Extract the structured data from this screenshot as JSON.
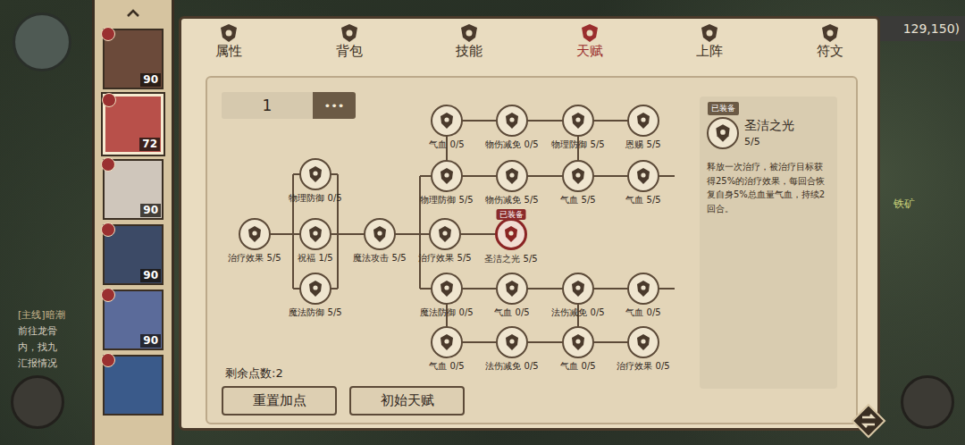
{
  "map": {
    "coords": "129,150)",
    "ore_label": "铁矿",
    "quest": {
      "title": "[主线]暗潮",
      "lines": [
        "前往龙骨",
        "内，找九",
        "汇报情况"
      ]
    }
  },
  "heroes": [
    {
      "level": "90",
      "selected": false,
      "color": "#6b4a3a"
    },
    {
      "level": "72",
      "selected": true,
      "color": "#b8504a"
    },
    {
      "level": "90",
      "selected": false,
      "color": "#cfc6bb"
    },
    {
      "level": "90",
      "selected": false,
      "color": "#3c4a66"
    },
    {
      "level": "90",
      "selected": false,
      "color": "#5b6b9a"
    },
    {
      "selected": false,
      "color": "#3a5a8a"
    }
  ],
  "tabs": [
    {
      "label": "属性",
      "selected": false
    },
    {
      "label": "背包",
      "selected": false
    },
    {
      "label": "技能",
      "selected": false
    },
    {
      "label": "天赋",
      "selected": true
    },
    {
      "label": "上阵",
      "selected": false
    },
    {
      "label": "符文",
      "selected": false
    }
  ],
  "page_input": {
    "value": "1",
    "more": "•••"
  },
  "nodes": [
    {
      "name": "治疗效果",
      "points": "5/5",
      "selected": false
    },
    {
      "name": "物理防御",
      "points": "0/5",
      "selected": false
    },
    {
      "name": "祝福",
      "points": "1/5",
      "selected": false
    },
    {
      "name": "魔法防御",
      "points": "5/5",
      "selected": false
    },
    {
      "name": "魔法攻击",
      "points": "5/5",
      "selected": false
    },
    {
      "name": "治疗效果",
      "points": "5/5",
      "selected": false
    },
    {
      "name": "圣洁之光",
      "points": "5/5",
      "selected": true,
      "badge": "已装备"
    },
    {
      "name": "气血",
      "points": "0/5",
      "selected": false
    },
    {
      "name": "物伤减免",
      "points": "0/5",
      "selected": false
    },
    {
      "name": "物理防御",
      "points": "5/5",
      "selected": false
    },
    {
      "name": "恩赐",
      "points": "5/5",
      "selected": false
    },
    {
      "name": "物理防御",
      "points": "5/5",
      "selected": false
    },
    {
      "name": "物伤减免",
      "points": "5/5",
      "selected": false
    },
    {
      "name": "气血",
      "points": "5/5",
      "selected": false
    },
    {
      "name": "气血",
      "points": "5/5",
      "selected": false
    },
    {
      "name": "魔法防御",
      "points": "0/5",
      "selected": false
    },
    {
      "name": "气血",
      "points": "0/5",
      "selected": false
    },
    {
      "name": "法伤减免",
      "points": "0/5",
      "selected": false
    },
    {
      "name": "气血",
      "points": "0/5",
      "selected": false
    },
    {
      "name": "气血",
      "points": "0/5",
      "selected": false
    },
    {
      "name": "法伤减免",
      "points": "0/5",
      "selected": false
    },
    {
      "name": "气血",
      "points": "0/5",
      "selected": false
    },
    {
      "name": "治疗效果",
      "points": "0/5",
      "selected": false
    }
  ],
  "detail": {
    "badge": "已装备",
    "name": "圣洁之光",
    "points": "5/5",
    "description": "释放一次治疗，被治疗目标获得25%的治疗效果，每回合恢复自身5%总血量气血，持续2回合。"
  },
  "remaining": "剩余点数:2",
  "buttons": [
    "重置加点",
    "初始天赋"
  ]
}
